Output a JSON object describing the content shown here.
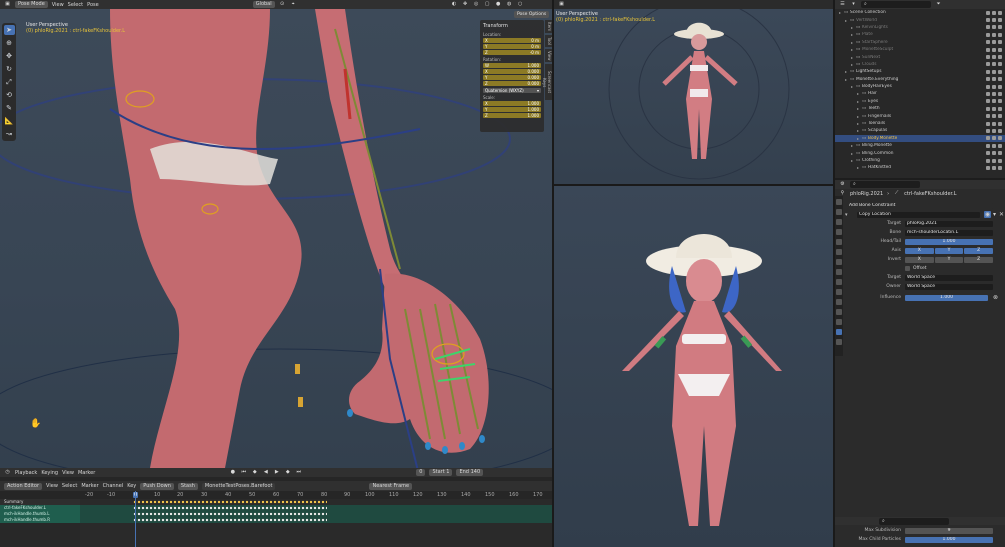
{
  "left_header": {
    "mode": "Pose Mode",
    "menu": [
      "View",
      "Select",
      "Pose"
    ],
    "orientation": "Global"
  },
  "left_viewport": {
    "perspective": "User Perspective",
    "active": "(0) phloRig.2021 : ctrl-fakeFKshoulder.L"
  },
  "npanel": {
    "pose_options": "Pose Options",
    "transform_title": "Transform",
    "location_label": "Location:",
    "location": [
      {
        "axis": "X",
        "value": "0 m"
      },
      {
        "axis": "Y",
        "value": "0 m"
      },
      {
        "axis": "Z",
        "value": "-0 m"
      }
    ],
    "rotation_label": "Rotation:",
    "rotation": [
      {
        "axis": "W",
        "value": "1.000"
      },
      {
        "axis": "X",
        "value": "0.000"
      },
      {
        "axis": "Y",
        "value": "0.000"
      },
      {
        "axis": "Z",
        "value": "0.000"
      }
    ],
    "rotation_mode": "Quaternion (WXYZ)",
    "scale_label": "Scale:",
    "scale": [
      {
        "axis": "X",
        "value": "1.000"
      },
      {
        "axis": "Y",
        "value": "1.000"
      },
      {
        "axis": "Z",
        "value": "1.000"
      }
    ],
    "tabs": [
      "Item",
      "Tool",
      "View",
      "Screencast Keys"
    ]
  },
  "right_top_viewport": {
    "perspective": "User Perspective",
    "active": "(0) phloRig.2021 : ctrl-fakeFKshoulder.L"
  },
  "timeline": {
    "menu": [
      "Playback",
      "Keying",
      "View",
      "Marker"
    ],
    "current_frame": "0",
    "start_label": "Start",
    "start": "1",
    "end_label": "End",
    "end": "140"
  },
  "action_editor": {
    "mode": "Action Editor",
    "menu": [
      "View",
      "Select",
      "Marker",
      "Channel",
      "Key"
    ],
    "push_down": "Push Down",
    "stash": "Stash",
    "action_name": "MonetteTestPoses.Barefoot",
    "snap": "Nearest Frame",
    "ruler": [
      "-20",
      "-10",
      "0",
      "10",
      "20",
      "30",
      "40",
      "50",
      "60",
      "70",
      "80",
      "90",
      "100",
      "110",
      "120",
      "130",
      "140",
      "150",
      "160",
      "170"
    ],
    "channels": [
      {
        "name": "Summary",
        "type": "summary"
      },
      {
        "name": "ctrl-fakeFKshoulder.L",
        "type": "group"
      },
      {
        "name": "mch-ikHandle.thumb.L",
        "type": "group"
      },
      {
        "name": "mch-ikHandle.thumb.R",
        "type": "group"
      }
    ]
  },
  "outliner": {
    "rows": [
      {
        "label": "Scene Collection",
        "level": 0,
        "state": "normal"
      },
      {
        "label": "VertWorld",
        "level": 1,
        "state": "dim"
      },
      {
        "label": "KelvinLights",
        "level": 2,
        "state": "dim"
      },
      {
        "label": "Plate",
        "level": 2,
        "state": "dim"
      },
      {
        "label": "StartSphere",
        "level": 2,
        "state": "dim"
      },
      {
        "label": "MonetteSculpt",
        "level": 2,
        "state": "dim"
      },
      {
        "label": "SunNext",
        "level": 2,
        "state": "dim"
      },
      {
        "label": "Clouds",
        "level": 2,
        "state": "dim"
      },
      {
        "label": "LightSetups",
        "level": 1,
        "state": "normal"
      },
      {
        "label": "Monette.Everything",
        "level": 1,
        "state": "normal"
      },
      {
        "label": "BodyHairEyes",
        "level": 2,
        "state": "normal"
      },
      {
        "label": "Hair",
        "level": 3,
        "state": "normal"
      },
      {
        "label": "Eyes",
        "level": 3,
        "state": "normal"
      },
      {
        "label": "Teeth",
        "level": 3,
        "state": "normal"
      },
      {
        "label": "Fingernails",
        "level": 3,
        "state": "normal"
      },
      {
        "label": "Toenails",
        "level": 3,
        "state": "normal"
      },
      {
        "label": "Scapulas",
        "level": 3,
        "state": "normal"
      },
      {
        "label": "Body.Monette",
        "level": 3,
        "state": "selected"
      },
      {
        "label": "Bling.Monette",
        "level": 2,
        "state": "normal"
      },
      {
        "label": "Bling.Common",
        "level": 2,
        "state": "normal"
      },
      {
        "label": "Clothing",
        "level": 2,
        "state": "normal"
      },
      {
        "label": "HatKnitted",
        "level": 3,
        "state": "normal"
      }
    ]
  },
  "properties": {
    "breadcrumb_rig": "phloRig.2021",
    "breadcrumb_bone": "ctrl-fakeFKshoulder.L",
    "add_constraint": "Add Bone Constraint",
    "constraint_name": "Copy Location",
    "target_label": "Target",
    "target_value": "phloRig.2021",
    "bone_label": "Bone",
    "bone_value": "mch-shoulderLocatin.L",
    "headtail_label": "Head/Tail",
    "headtail_value": "1.000",
    "axis_label": "Axis",
    "invert_label": "Invert",
    "axes": [
      "X",
      "Y",
      "Z"
    ],
    "offset_label": "Offset",
    "target_space_label": "Target",
    "target_space": "World Space",
    "owner_space_label": "Owner",
    "owner_space": "World Space",
    "influence_label": "Influence",
    "influence_value": "1.000",
    "bottom_rows": [
      {
        "label": "Max Subdivision",
        "value": "9"
      },
      {
        "label": "Max Child Particles",
        "value": "1.000"
      }
    ]
  },
  "colors": {
    "selection_blue": "#4772b3",
    "keyframe_yellow": "#f0c24a",
    "active_text": "#e6c33a"
  }
}
